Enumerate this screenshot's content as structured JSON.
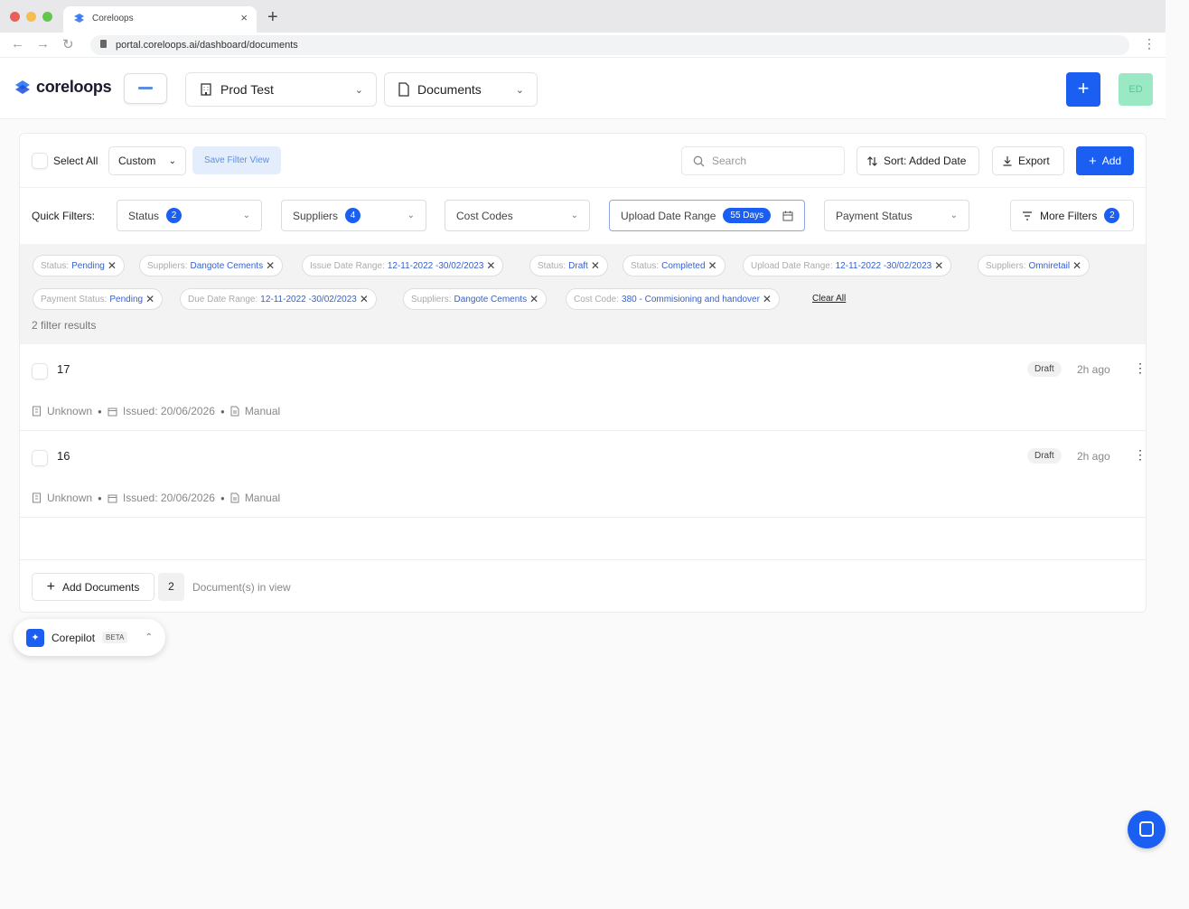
{
  "browser": {
    "tab_title": "Coreloops",
    "tab_close": "×",
    "new_tab": "+",
    "url": "portal.coreloops.ai/dashboard/documents",
    "back": "←",
    "forward": "→",
    "reload": "↻",
    "menu": "⋮"
  },
  "header": {
    "logo_text": "coreloops",
    "project_select": "Prod Test",
    "module_select": "Documents",
    "create_label": "+",
    "avatar_initials": "ED",
    "chev": "⌄"
  },
  "toolbar": {
    "select_all": "Select All",
    "view_select": "Custom",
    "save_filter": "Save Filter View",
    "search_placeholder": "Search",
    "sort_label": "Sort: Added Date",
    "export_label": "Export",
    "add_label": "Add"
  },
  "quick_filters": {
    "label": "Quick Filters:",
    "status": {
      "label": "Status",
      "count": "2"
    },
    "suppliers": {
      "label": "Suppliers",
      "count": "4"
    },
    "cost_codes": {
      "label": "Cost Codes"
    },
    "upload_range": {
      "label": "Upload Date Range",
      "badge": "55 Days"
    },
    "payment_status": {
      "label": "Payment Status"
    },
    "more_filters": {
      "label": "More Filters",
      "count": "2"
    }
  },
  "chips": [
    {
      "key": "Status:",
      "value": "Pending"
    },
    {
      "key": "Suppliers:",
      "value": "Dangote Cements"
    },
    {
      "key": "Issue Date Range:",
      "value": "12-11-2022 -30/02/2023"
    },
    {
      "key": "Status:",
      "value": "Draft"
    },
    {
      "key": "Status:",
      "value": "Completed"
    },
    {
      "key": "Upload Date Range:",
      "value": "12-11-2022 -30/02/2023"
    },
    {
      "key": "Suppliers:",
      "value": "Omniretail"
    },
    {
      "key": "Payment Status:",
      "value": "Pending"
    },
    {
      "key": "Due Date Range:",
      "value": "12-11-2022 -30/02/2023"
    },
    {
      "key": "Suppliers:",
      "value": "Dangote Cements"
    },
    {
      "key": "Cost Code:",
      "value": "380 - Commisioning and handover"
    }
  ],
  "chip_remove": "✕",
  "clear_all": "Clear All",
  "results_text": "2 filter results",
  "documents": [
    {
      "id": "17",
      "supplier": "Unknown",
      "issued": "Issued: 20/06/2026",
      "source": "Manual",
      "status": "Draft",
      "age": "2h ago"
    },
    {
      "id": "16",
      "supplier": "Unknown",
      "issued": "Issued: 20/06/2026",
      "source": "Manual",
      "status": "Draft",
      "age": "2h ago"
    }
  ],
  "footer": {
    "add_documents": "Add Documents",
    "count": "2",
    "in_view": "Document(s) in view"
  },
  "copilot": {
    "label": "Corepilot",
    "beta": "BETA"
  },
  "colors": {
    "accent": "#1a5ef2",
    "avatar_bg": "#9be8c5"
  }
}
